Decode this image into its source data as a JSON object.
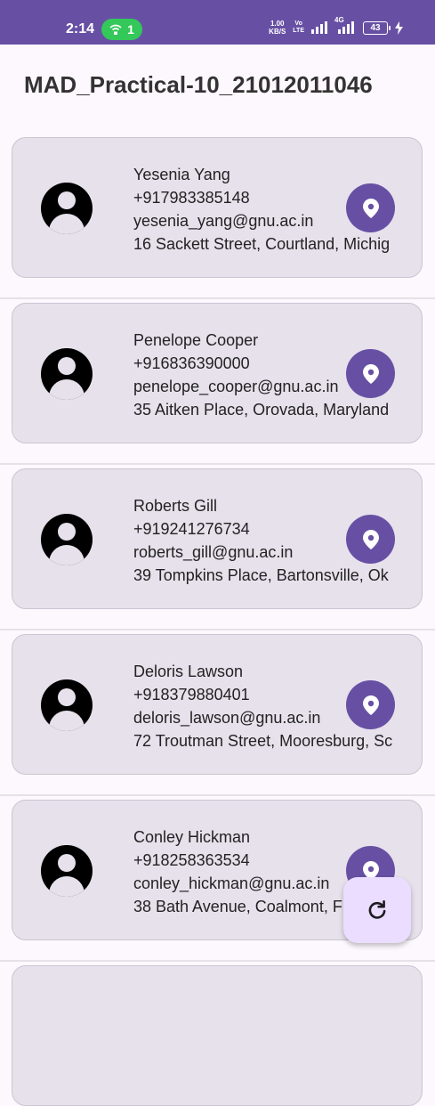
{
  "status_bar": {
    "time": "2:14",
    "hotspot_count": "1",
    "net_speed_value": "1.00",
    "net_speed_unit": "KB/S",
    "volte_top": "Vo",
    "volte_bottom": "LTE",
    "network_label": "4G",
    "battery": "43"
  },
  "app": {
    "title": "MAD_Practical-10_21012011046"
  },
  "contacts": [
    {
      "name": "Yesenia Yang",
      "phone": "+917983385148",
      "email": "yesenia_yang@gnu.ac.in",
      "address": "16 Sackett Street, Courtland, Michig"
    },
    {
      "name": "Penelope Cooper",
      "phone": "+916836390000",
      "email": "penelope_cooper@gnu.ac.in",
      "address": "35 Aitken Place, Orovada, Maryland"
    },
    {
      "name": "Roberts Gill",
      "phone": "+919241276734",
      "email": "roberts_gill@gnu.ac.in",
      "address": "39 Tompkins Place, Bartonsville, Ok"
    },
    {
      "name": "Deloris Lawson",
      "phone": "+918379880401",
      "email": "deloris_lawson@gnu.ac.in",
      "address": "72 Troutman Street, Mooresburg, Sc"
    },
    {
      "name": "Conley Hickman",
      "phone": "+918258363534",
      "email": "conley_hickman@gnu.ac.in",
      "address": "38 Bath Avenue, Coalmont, F"
    }
  ],
  "icons": {
    "avatar": "person-icon",
    "location": "location-pin-icon",
    "refresh": "refresh-icon"
  },
  "colors": {
    "primary": "#6750a4",
    "card": "#e7e1ec",
    "fab": "#eaddff",
    "hotspot": "#34c759"
  }
}
